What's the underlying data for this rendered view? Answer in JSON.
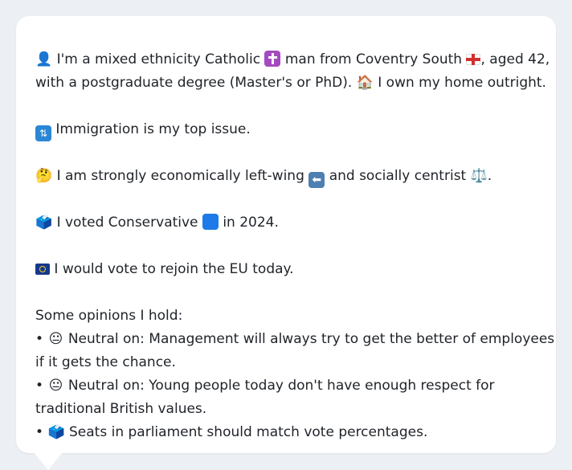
{
  "profile": {
    "line1_pre": "I'm a mixed ethnicity Catholic",
    "line1_mid": "man from Coventry South",
    "line1_post": ", aged 42,",
    "line2_pre": "with a postgraduate degree (Master's or PhD).",
    "line2_post": "I own my home outright."
  },
  "issue": {
    "text": "Immigration is my top issue."
  },
  "ideology": {
    "pre": "I am strongly economically left-wing",
    "mid": "and socially centrist",
    "post": "."
  },
  "vote": {
    "pre": "I voted Conservative",
    "post": "in 2024."
  },
  "eu": {
    "text": "I would vote to rejoin the EU today."
  },
  "opinions": {
    "heading": "Some opinions I hold:",
    "items": [
      {
        "bullet": "•",
        "line1": "Neutral on: Management will always try to get the better of employees",
        "line2": "if it gets the chance."
      },
      {
        "bullet": "•",
        "line1": "Neutral on: Young people today don't have enough respect for",
        "line2": "traditional British values."
      },
      {
        "bullet": "•",
        "line1": "Seats in parliament should match vote percentages."
      }
    ]
  },
  "icons": {
    "person": "👤",
    "house": "🏠",
    "thinking": "🤔",
    "scales": "⚖️",
    "ballot": "🗳️",
    "neutral": "😐",
    "arrow_left": "⬅"
  },
  "colors": {
    "card": "#ffffff",
    "background": "#eceff3",
    "text": "#1f2328"
  }
}
